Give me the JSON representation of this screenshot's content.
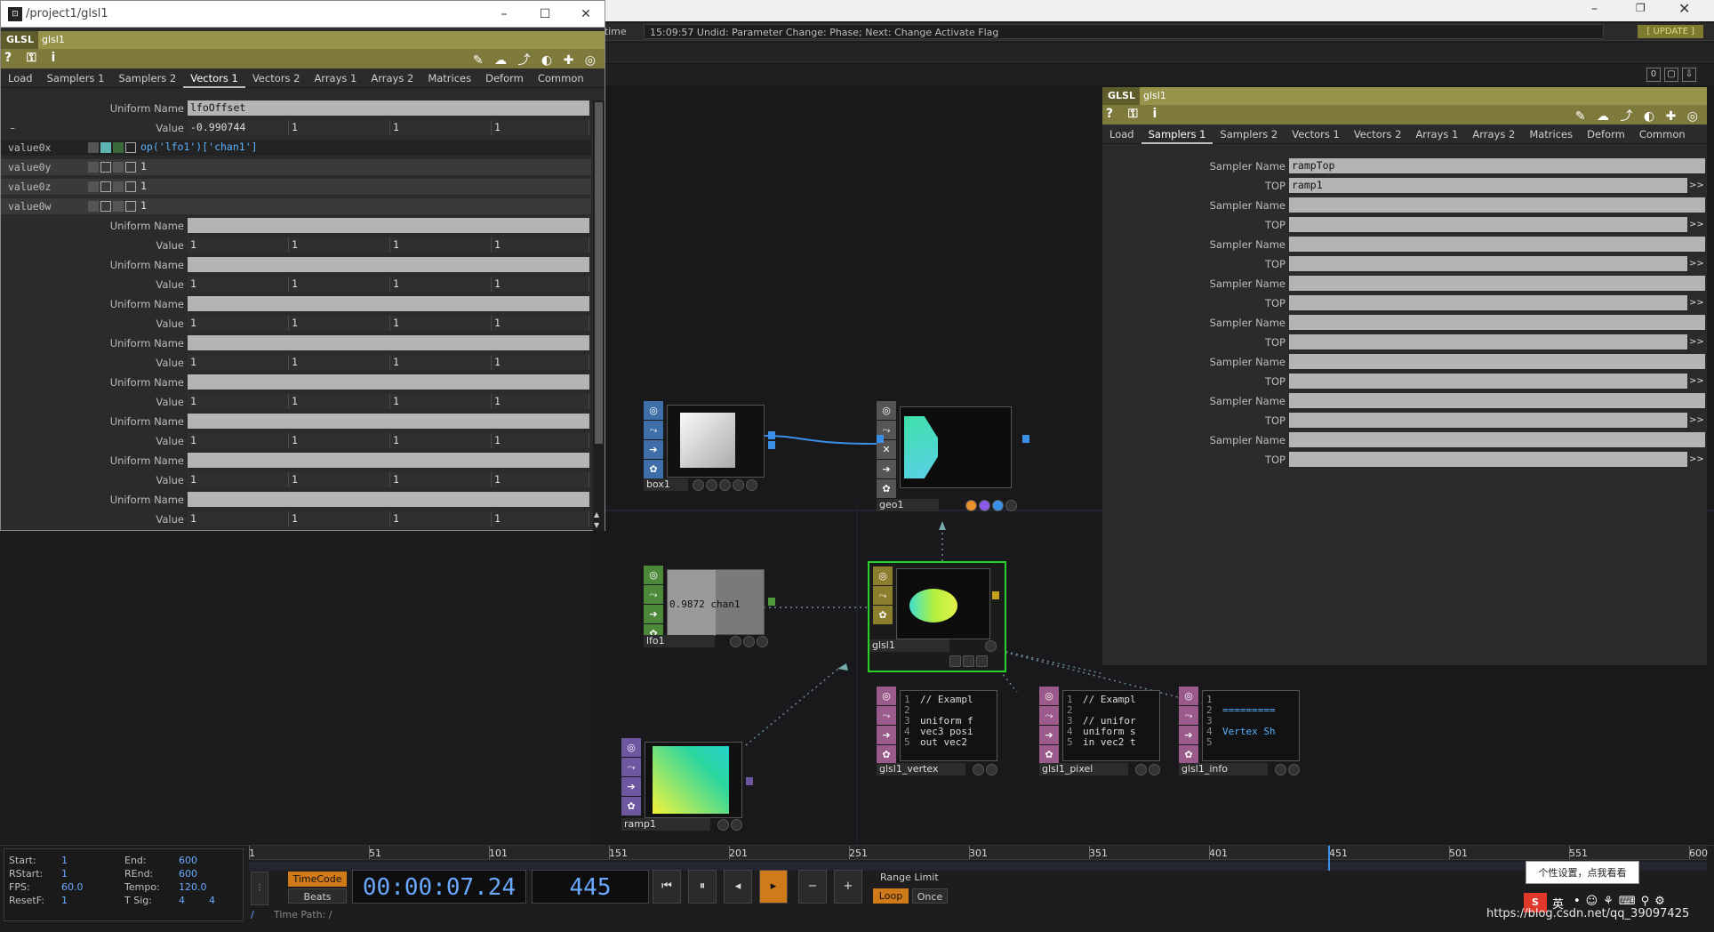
{
  "status": {
    "realtime": "altime",
    "message": "15:09:57 Undid: Parameter Change: Phase; Next: Change Activate Flag",
    "update": "[ UPDATE ]"
  },
  "pane_buttons": [
    "0",
    "▢",
    "⇩"
  ],
  "left_panel": {
    "window_title": "/project1/glsl1",
    "op_type": "GLSL",
    "op_name": "glsl1",
    "tabs": [
      "Load",
      "Samplers 1",
      "Samplers 2",
      "Vectors 1",
      "Vectors 2",
      "Arrays 1",
      "Arrays 2",
      "Matrices",
      "Deform",
      "Common"
    ],
    "active_tab": "Vectors 1",
    "uniform_name_label": "Uniform Name",
    "value_label": "Value",
    "first": {
      "uniform_name": "lfoOffset",
      "value": [
        "-0.990744",
        "1",
        "1",
        "1"
      ],
      "expanded": [
        {
          "label": "value0x",
          "expr": "op('lfo1')['chan1']"
        },
        {
          "label": "value0y",
          "expr": "1"
        },
        {
          "label": "value0z",
          "expr": "1"
        },
        {
          "label": "value0w",
          "expr": "1"
        }
      ]
    },
    "blank_value": [
      "1",
      "1",
      "1",
      "1"
    ]
  },
  "right_panel": {
    "op_type": "GLSL",
    "op_name": "glsl1",
    "tabs": [
      "Load",
      "Samplers 1",
      "Samplers 2",
      "Vectors 1",
      "Vectors 2",
      "Arrays 1",
      "Arrays 2",
      "Matrices",
      "Deform",
      "Common"
    ],
    "active_tab": "Samplers 1",
    "sampler_name_label": "Sampler Name",
    "top_label": "TOP",
    "samplers": [
      {
        "name": "rampTop",
        "top": "ramp1"
      },
      {
        "name": "",
        "top": ""
      },
      {
        "name": "",
        "top": ""
      },
      {
        "name": "",
        "top": ""
      },
      {
        "name": "",
        "top": ""
      },
      {
        "name": "",
        "top": ""
      },
      {
        "name": "",
        "top": ""
      },
      {
        "name": "",
        "top": ""
      }
    ]
  },
  "nodes": {
    "box1": "box1",
    "geo1": "geo1",
    "lfo1": "lfo1",
    "lfo_value": "0.9872 chan1",
    "glsl1": "glsl1",
    "glsl1_vertex": "glsl1_vertex",
    "glsl1_pixel": "glsl1_pixel",
    "glsl1_info": "glsl1_info",
    "ramp1": "ramp1",
    "vertex_code": [
      "// Exampl",
      "",
      "uniform f",
      "vec3 posi",
      "out vec2"
    ],
    "pixel_code": [
      "// Exampl",
      "",
      "// unifor",
      "uniform s",
      "in vec2 t"
    ],
    "info_code": [
      "",
      "=========",
      "",
      "Vertex Sh",
      ""
    ]
  },
  "timeline": {
    "ticks": [
      "1",
      "51",
      "101",
      "151",
      "201",
      "251",
      "301",
      "351",
      "401",
      "451",
      "501",
      "551",
      "600"
    ],
    "start_label": "Start:",
    "start": "1",
    "end_label": "End:",
    "end": "600",
    "rstart_label": "RStart:",
    "rstart": "1",
    "rend_label": "REnd:",
    "rend": "600",
    "fps_label": "FPS:",
    "fps": "60.0",
    "tempo_label": "Tempo:",
    "tempo": "120.0",
    "resetf_label": "ResetF:",
    "resetf": "1",
    "tsig_label": "T Sig:",
    "tsig_a": "4",
    "tsig_b": "4",
    "timecode_btn": "TimeCode",
    "beats_btn": "Beats",
    "timecode": "00:00:07.24",
    "frame": "445",
    "range_limit": "Range Limit",
    "loop": "Loop",
    "once": "Once",
    "time_path": "Time Path: /"
  },
  "tray": {
    "tooltip": "个性设置，点我看看",
    "watermark": "https://blog.csdn.net/qq_39097425",
    "ime": "英"
  }
}
